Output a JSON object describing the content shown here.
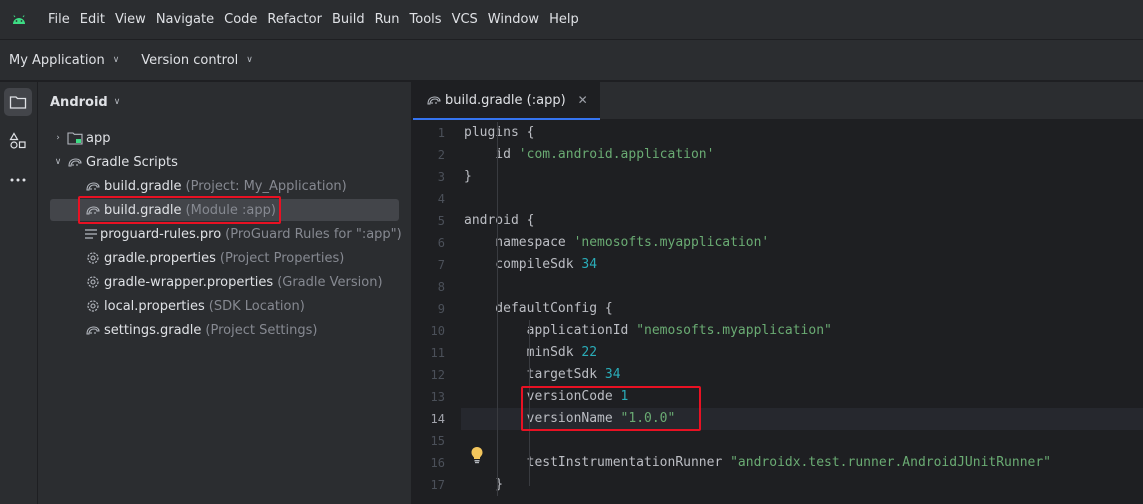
{
  "menubar": {
    "items": [
      "File",
      "Edit",
      "View",
      "Navigate",
      "Code",
      "Refactor",
      "Build",
      "Run",
      "Tools",
      "VCS",
      "Window",
      "Help"
    ]
  },
  "toolbar": {
    "project_name": "My Application",
    "version_control": "Version control"
  },
  "project_panel": {
    "view_mode": "Android",
    "tree": [
      {
        "label": "app",
        "hint": "",
        "type": "module"
      },
      {
        "label": "Gradle Scripts",
        "hint": "",
        "type": "gradle-folder"
      },
      {
        "label": "build.gradle",
        "hint": "(Project: My_Application)",
        "type": "gradle"
      },
      {
        "label": "build.gradle",
        "hint": "(Module :app)",
        "type": "gradle",
        "selected": true
      },
      {
        "label": "proguard-rules.pro",
        "hint": "(ProGuard Rules for \":app\")",
        "type": "text"
      },
      {
        "label": "gradle.properties",
        "hint": "(Project Properties)",
        "type": "properties"
      },
      {
        "label": "gradle-wrapper.properties",
        "hint": "(Gradle Version)",
        "type": "properties"
      },
      {
        "label": "local.properties",
        "hint": "(SDK Location)",
        "type": "properties"
      },
      {
        "label": "settings.gradle",
        "hint": "(Project Settings)",
        "type": "gradle"
      }
    ]
  },
  "editor": {
    "tab_label": "build.gradle (:app)",
    "current_line": 14,
    "line_numbers": [
      "1",
      "2",
      "3",
      "4",
      "5",
      "6",
      "7",
      "8",
      "9",
      "10",
      "11",
      "12",
      "13",
      "14",
      "15",
      "16",
      "17"
    ],
    "lines": [
      "plugins {",
      "    id 'com.android.application'",
      "}",
      "",
      "android {",
      "    namespace 'nemosofts.myapplication'",
      "    compileSdk 34",
      "",
      "    defaultConfig {",
      "        applicationId \"nemosofts.myapplication\"",
      "        minSdk 22",
      "        targetSdk 34",
      "        versionCode 1",
      "        versionName \"1.0.0\"",
      "",
      "        testInstrumentationRunner \"androidx.test.runner.AndroidJUnitRunner\"",
      "    }"
    ]
  },
  "icons": {
    "app_logo": "android-icon",
    "folder": "folder-icon",
    "resource_manager": "shapes-icon",
    "more": "more-icon",
    "gradle": "gradle-elephant-icon",
    "properties": "gear-icon",
    "text_file": "text-lines-icon",
    "module": "module-folder-icon",
    "bulb": "lightbulb-icon"
  },
  "colors": {
    "highlight": "#e81123",
    "string": "#6aab73",
    "number": "#2aacb8",
    "accent": "#3574f0"
  }
}
